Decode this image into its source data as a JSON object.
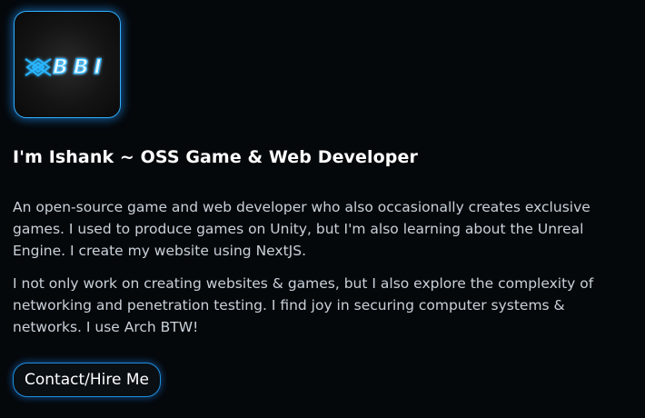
{
  "profile": {
    "logo_text": "BBI",
    "logo_icon": "bbi-logo-icon",
    "title": "I'm Ishank ~ OSS Game & Web Developer",
    "paragraphs": [
      "An open-source game and web developer who also occasionally creates exclusive games. I used to produce games on Unity, but I'm also learning about the Unreal Engine. I create my website using NextJS.",
      "I not only work on creating websites & games, but I also explore the complexity of networking and penetration testing. I find joy in securing computer systems & networks. I use Arch BTW!"
    ],
    "contact_label": "Contact/Hire Me"
  },
  "colors": {
    "background": "#05080b",
    "accent": "#2fb0ff",
    "text": "#ffffff",
    "body_text": "#c9d1d9"
  }
}
